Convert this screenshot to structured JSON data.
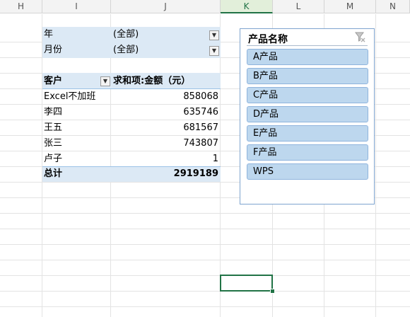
{
  "columns": [
    "H",
    "I",
    "J",
    "K",
    "L",
    "M",
    "N"
  ],
  "filters": [
    {
      "label": "年",
      "value": "(全部)"
    },
    {
      "label": "月份",
      "value": "(全部)"
    }
  ],
  "pivot": {
    "header_customer": "客户",
    "header_sum": "求和项:金额（元）",
    "rows": [
      {
        "name": "Excel不加班",
        "amount": "858068"
      },
      {
        "name": "李四",
        "amount": "635746"
      },
      {
        "name": "王五",
        "amount": "681567"
      },
      {
        "name": "张三",
        "amount": "743807"
      },
      {
        "name": "卢子",
        "amount": "1"
      }
    ],
    "total_label": "总计",
    "total_value": "2919189"
  },
  "slicer": {
    "title": "产品名称",
    "items": [
      "A产品",
      "B产品",
      "C产品",
      "D产品",
      "E产品",
      "F产品",
      "WPS"
    ]
  },
  "icons": {
    "filter_dropdown": "dropdown-arrow-icon",
    "slicer_clear": "clear-filter-icon"
  }
}
